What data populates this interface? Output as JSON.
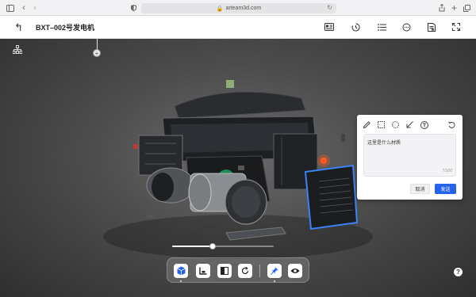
{
  "browser": {
    "url": "arteam3d.com",
    "icons": [
      "sidebar-toggle-icon",
      "back-icon",
      "forward-icon",
      "shield-icon",
      "lock-icon",
      "reload-icon",
      "share-icon",
      "new-tab-icon",
      "tabs-icon"
    ]
  },
  "header": {
    "title": "BXT–002号发电机",
    "back_icon": "↰"
  },
  "toolbar_icons": [
    "list-card-icon",
    "clock-rotate-icon",
    "list-icon",
    "chat-icon",
    "document-icon",
    "fullscreen-icon"
  ],
  "slider": {
    "value": 0.4
  },
  "bottom_toolbar": {
    "buttons": [
      "cube-icon",
      "section-icon",
      "split-icon",
      "reset-icon",
      "pin-icon",
      "eye-icon"
    ]
  },
  "panel": {
    "tools": [
      "pencil-icon",
      "rectangle-icon",
      "circle-icon",
      "arrow-icon",
      "text-icon",
      "undo-icon"
    ],
    "input_value": "这里是什么材质",
    "counter": "7/100",
    "cancel_label": "取消",
    "send_label": "发送"
  },
  "help_label": "?",
  "colors": {
    "accent": "#2563eb",
    "hotspot": "#ff5a1f",
    "highlight": "#3b82f6"
  }
}
